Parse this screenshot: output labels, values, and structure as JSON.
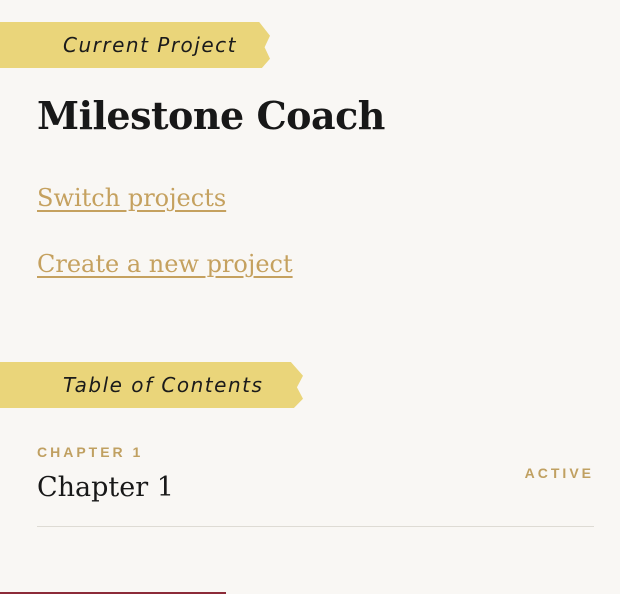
{
  "current_project": {
    "section_label": "Current Project",
    "title": "Milestone Coach",
    "links": {
      "switch": "Switch projects",
      "create": "Create a new project"
    }
  },
  "toc": {
    "section_label": "Table of Contents",
    "chapters": [
      {
        "kicker": "CHAPTER 1",
        "title": "Chapter 1",
        "status": "ACTIVE"
      }
    ]
  },
  "colors": {
    "background": "#f9f7f4",
    "tape": "#ead57a",
    "link_gold": "#c5a15f",
    "kicker_gold": "#c0a061",
    "divider": "#dedbd4",
    "bottom_accent": "#8c2b38"
  }
}
